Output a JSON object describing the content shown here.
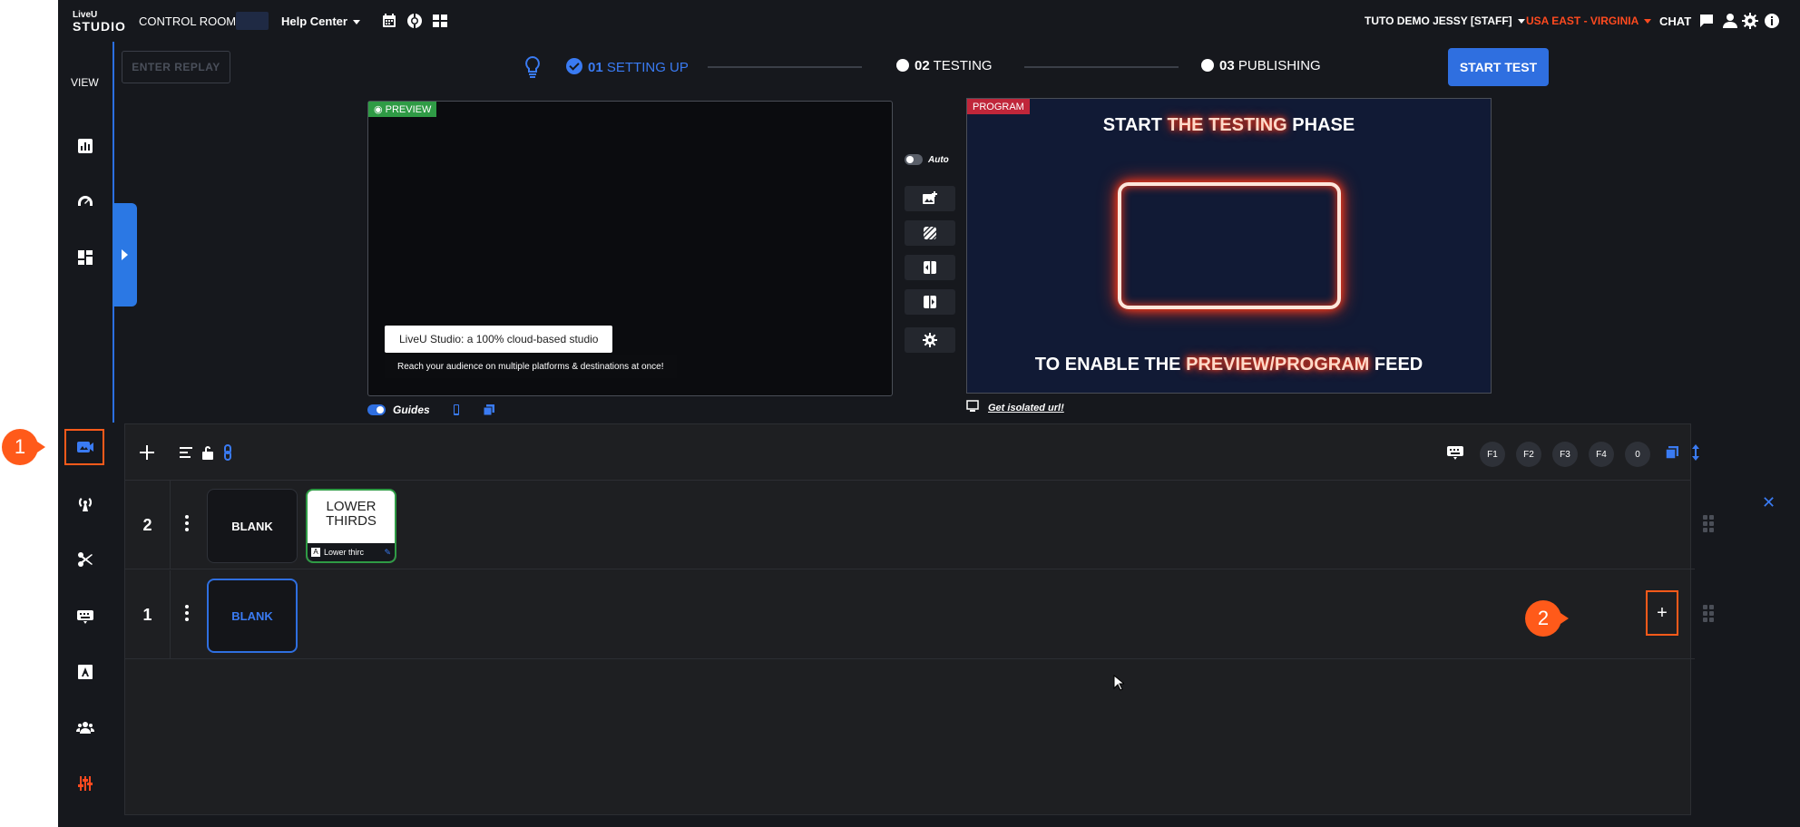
{
  "topbar": {
    "logo_top": "LiveU",
    "logo_bottom": "STUDIO",
    "control_rooms": "CONTROL ROOMS",
    "help_center": "Help Center",
    "user": "TUTO DEMO JESSY [STAFF]",
    "region": "USA EAST - VIRGINIA",
    "chat": "CHAT"
  },
  "rail": {
    "view_label": "VIEW"
  },
  "header": {
    "replay_button": "ENTER REPLAY",
    "step1_num": "01",
    "step1_label": "SETTING UP",
    "step2_num": "02",
    "step2_label": "TESTING",
    "step3_num": "03",
    "step3_label": "PUBLISHING",
    "start_test": "START TEST"
  },
  "preview": {
    "tag": "PREVIEW",
    "lower_third_title": "LiveU Studio: a 100% cloud-based studio",
    "lower_third_sub": "Reach your audience on multiple platforms & destinations at once!",
    "guides_label": "Guides"
  },
  "controls": {
    "auto_label": "Auto"
  },
  "program": {
    "tag": "PROGRAM",
    "title_a": "START ",
    "title_b": "THE TESTING",
    "title_c": " PHASE",
    "bottom_a": "TO ENABLE THE ",
    "bottom_b": "PREVIEW/PROGRAM",
    "bottom_c": " FEED",
    "isolated_url": "Get isolated url!"
  },
  "layers": {
    "fkeys": [
      "F1",
      "F2",
      "F3",
      "F4",
      "0"
    ],
    "rows": [
      {
        "num": "2",
        "slot1": "BLANK",
        "slot2_line1": "LOWER",
        "slot2_line2": "THIRDS",
        "slot2_caption": "Lower thirc"
      },
      {
        "num": "1",
        "slot1": "BLANK"
      }
    ]
  },
  "callouts": {
    "one": "1",
    "two": "2"
  },
  "colors": {
    "accent": "#2f6fe0",
    "region": "#ff4a1f",
    "callout": "#ff5a1a",
    "preview_tag": "#2f9b45",
    "program_tag": "#c0263a"
  }
}
